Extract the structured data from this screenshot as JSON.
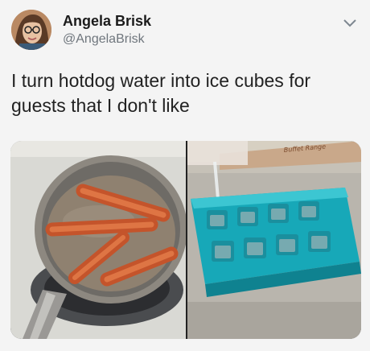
{
  "tweet": {
    "author_name": "Angela Brisk",
    "author_handle": "@AngelaBrisk",
    "text": "I turn hotdog water into ice cubes for guests that I don't like"
  },
  "media": {
    "images": [
      {
        "subject": "pot of boiling hotdogs"
      },
      {
        "subject": "water poured into blue ice cube tray",
        "visible_text": "Buffet Range"
      }
    ]
  },
  "icons": {
    "menu": "chevron-down-icon"
  }
}
